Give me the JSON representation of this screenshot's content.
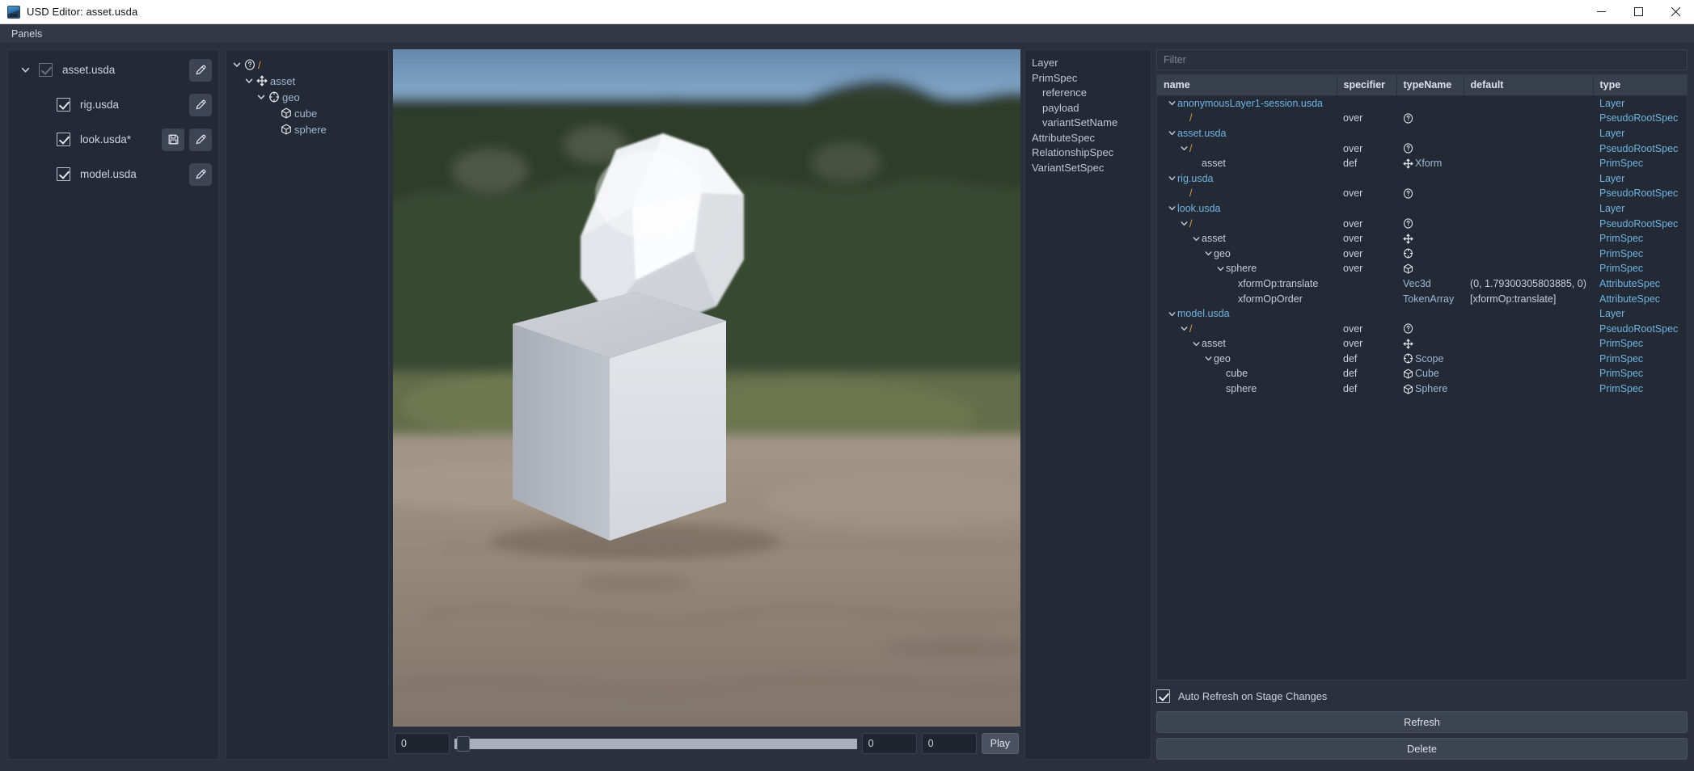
{
  "window": {
    "title": "USD Editor: asset.usda",
    "app_icon": "usd-editor-icon",
    "minimize": "minimize-icon",
    "maximize": "maximize-icon",
    "close": "close-icon"
  },
  "menubar": {
    "items": [
      {
        "label": "Panels"
      }
    ]
  },
  "layers_panel": {
    "rows": [
      {
        "name": "asset.usda",
        "checked": true,
        "dim": true,
        "expandable": true,
        "expanded": true,
        "indent": 0,
        "save": false,
        "edit": true
      },
      {
        "name": "rig.usda",
        "checked": true,
        "dim": false,
        "expandable": false,
        "expanded": false,
        "indent": 1,
        "save": false,
        "edit": true
      },
      {
        "name": "look.usda*",
        "checked": true,
        "dim": false,
        "expandable": false,
        "expanded": false,
        "indent": 1,
        "save": true,
        "edit": true
      },
      {
        "name": "model.usda",
        "checked": true,
        "dim": false,
        "expandable": false,
        "expanded": false,
        "indent": 1,
        "save": false,
        "edit": true
      }
    ],
    "save_icon": "save-disk-icon",
    "edit_icon": "pencil-edit-icon"
  },
  "tree_panel": {
    "nodes": [
      {
        "label": "/",
        "icon": "question-mark-icon",
        "indent": 0,
        "expanded": true,
        "expandable": true,
        "root": true
      },
      {
        "label": "asset",
        "icon": "xform-move-icon",
        "indent": 1,
        "expanded": true,
        "expandable": true,
        "root": false
      },
      {
        "label": "geo",
        "icon": "scope-target-icon",
        "indent": 2,
        "expanded": true,
        "expandable": true,
        "root": false
      },
      {
        "label": "cube",
        "icon": "cube-icon",
        "indent": 3,
        "expanded": false,
        "expandable": false,
        "root": false
      },
      {
        "label": "sphere",
        "icon": "cube-icon",
        "indent": 3,
        "expanded": false,
        "expandable": false,
        "root": false
      }
    ]
  },
  "viewport": {
    "description": "3D render: white faceted sphere resting on a white cube, blurred beach and forest HDRI background",
    "timeline": {
      "start_value": "0",
      "current_value": "0",
      "end_value": "0",
      "play_label": "Play",
      "handle_position_pct": 0
    }
  },
  "spec_types": {
    "items": [
      {
        "label": "Layer",
        "indent": 0
      },
      {
        "label": "PrimSpec",
        "indent": 0
      },
      {
        "label": "reference",
        "indent": 1
      },
      {
        "label": "payload",
        "indent": 1
      },
      {
        "label": "variantSetName",
        "indent": 1
      },
      {
        "label": "AttributeSpec",
        "indent": 0
      },
      {
        "label": "RelationshipSpec",
        "indent": 0
      },
      {
        "label": "VariantSetSpec",
        "indent": 0
      }
    ]
  },
  "table_panel": {
    "filter_placeholder": "Filter",
    "filter_value": "",
    "columns": [
      "name",
      "specifier",
      "typeName",
      "default",
      "type"
    ],
    "rows": [
      {
        "name": "anonymousLayer1-session.usda",
        "indent": 0,
        "expandable": true,
        "kind": "layer",
        "specifier": "",
        "typeName": "",
        "typeIcon": "",
        "default": "",
        "type": "Layer"
      },
      {
        "name": "/",
        "indent": 1,
        "expandable": false,
        "kind": "slash",
        "specifier": "over",
        "typeName": "",
        "typeIcon": "question-mark-icon",
        "default": "",
        "type": "PseudoRootSpec"
      },
      {
        "name": "asset.usda",
        "indent": 0,
        "expandable": true,
        "kind": "layer",
        "specifier": "",
        "typeName": "",
        "typeIcon": "",
        "default": "",
        "type": "Layer"
      },
      {
        "name": "/",
        "indent": 1,
        "expandable": true,
        "kind": "slash",
        "specifier": "over",
        "typeName": "",
        "typeIcon": "question-mark-icon",
        "default": "",
        "type": "PseudoRootSpec"
      },
      {
        "name": "asset",
        "indent": 2,
        "expandable": false,
        "kind": "prim",
        "specifier": "def",
        "typeName": "Xform",
        "typeIcon": "xform-move-icon",
        "default": "",
        "type": "PrimSpec"
      },
      {
        "name": "rig.usda",
        "indent": 0,
        "expandable": true,
        "kind": "layer",
        "specifier": "",
        "typeName": "",
        "typeIcon": "",
        "default": "",
        "type": "Layer"
      },
      {
        "name": "/",
        "indent": 1,
        "expandable": false,
        "kind": "slash",
        "specifier": "over",
        "typeName": "",
        "typeIcon": "question-mark-icon",
        "default": "",
        "type": "PseudoRootSpec"
      },
      {
        "name": "look.usda",
        "indent": 0,
        "expandable": true,
        "kind": "layer",
        "specifier": "",
        "typeName": "",
        "typeIcon": "",
        "default": "",
        "type": "Layer"
      },
      {
        "name": "/",
        "indent": 1,
        "expandable": true,
        "kind": "slash",
        "specifier": "over",
        "typeName": "",
        "typeIcon": "question-mark-icon",
        "default": "",
        "type": "PseudoRootSpec"
      },
      {
        "name": "asset",
        "indent": 2,
        "expandable": true,
        "kind": "prim",
        "specifier": "over",
        "typeName": "",
        "typeIcon": "xform-move-icon",
        "default": "",
        "type": "PrimSpec"
      },
      {
        "name": "geo",
        "indent": 3,
        "expandable": true,
        "kind": "prim",
        "specifier": "over",
        "typeName": "",
        "typeIcon": "scope-target-icon",
        "default": "",
        "type": "PrimSpec"
      },
      {
        "name": "sphere",
        "indent": 4,
        "expandable": true,
        "kind": "prim",
        "specifier": "over",
        "typeName": "",
        "typeIcon": "cube-icon",
        "default": "",
        "type": "PrimSpec"
      },
      {
        "name": "xformOp:translate",
        "indent": 5,
        "expandable": false,
        "kind": "attr",
        "specifier": "",
        "typeName": "Vec3d",
        "typeIcon": "",
        "default": "(0, 1.79300305803885, 0)",
        "type": "AttributeSpec"
      },
      {
        "name": "xformOpOrder",
        "indent": 5,
        "expandable": false,
        "kind": "attr",
        "specifier": "",
        "typeName": "TokenArray",
        "typeIcon": "",
        "default": "[xformOp:translate]",
        "type": "AttributeSpec"
      },
      {
        "name": "model.usda",
        "indent": 0,
        "expandable": true,
        "kind": "layer",
        "specifier": "",
        "typeName": "",
        "typeIcon": "",
        "default": "",
        "type": "Layer"
      },
      {
        "name": "/",
        "indent": 1,
        "expandable": true,
        "kind": "slash",
        "specifier": "over",
        "typeName": "",
        "typeIcon": "question-mark-icon",
        "default": "",
        "type": "PseudoRootSpec"
      },
      {
        "name": "asset",
        "indent": 2,
        "expandable": true,
        "kind": "prim",
        "specifier": "over",
        "typeName": "",
        "typeIcon": "xform-move-icon",
        "default": "",
        "type": "PrimSpec"
      },
      {
        "name": "geo",
        "indent": 3,
        "expandable": true,
        "kind": "prim",
        "specifier": "def",
        "typeName": "Scope",
        "typeIcon": "scope-target-icon",
        "default": "",
        "type": "PrimSpec"
      },
      {
        "name": "cube",
        "indent": 4,
        "expandable": false,
        "kind": "prim",
        "specifier": "def",
        "typeName": "Cube",
        "typeIcon": "cube-icon",
        "default": "",
        "type": "PrimSpec"
      },
      {
        "name": "sphere",
        "indent": 4,
        "expandable": false,
        "kind": "prim",
        "specifier": "def",
        "typeName": "Sphere",
        "typeIcon": "cube-icon",
        "default": "",
        "type": "PrimSpec"
      }
    ]
  },
  "bottom_controls": {
    "auto_refresh_label": "Auto Refresh on Stage Changes",
    "auto_refresh_checked": true,
    "refresh_label": "Refresh",
    "delete_label": "Delete"
  },
  "colors": {
    "window_bg": "#2b313c",
    "panel_bg": "#242a35",
    "header_bg": "#383f4d",
    "accent_link": "#6fb3e0",
    "accent_root": "#d89a4a",
    "text": "#c7ccd6"
  }
}
